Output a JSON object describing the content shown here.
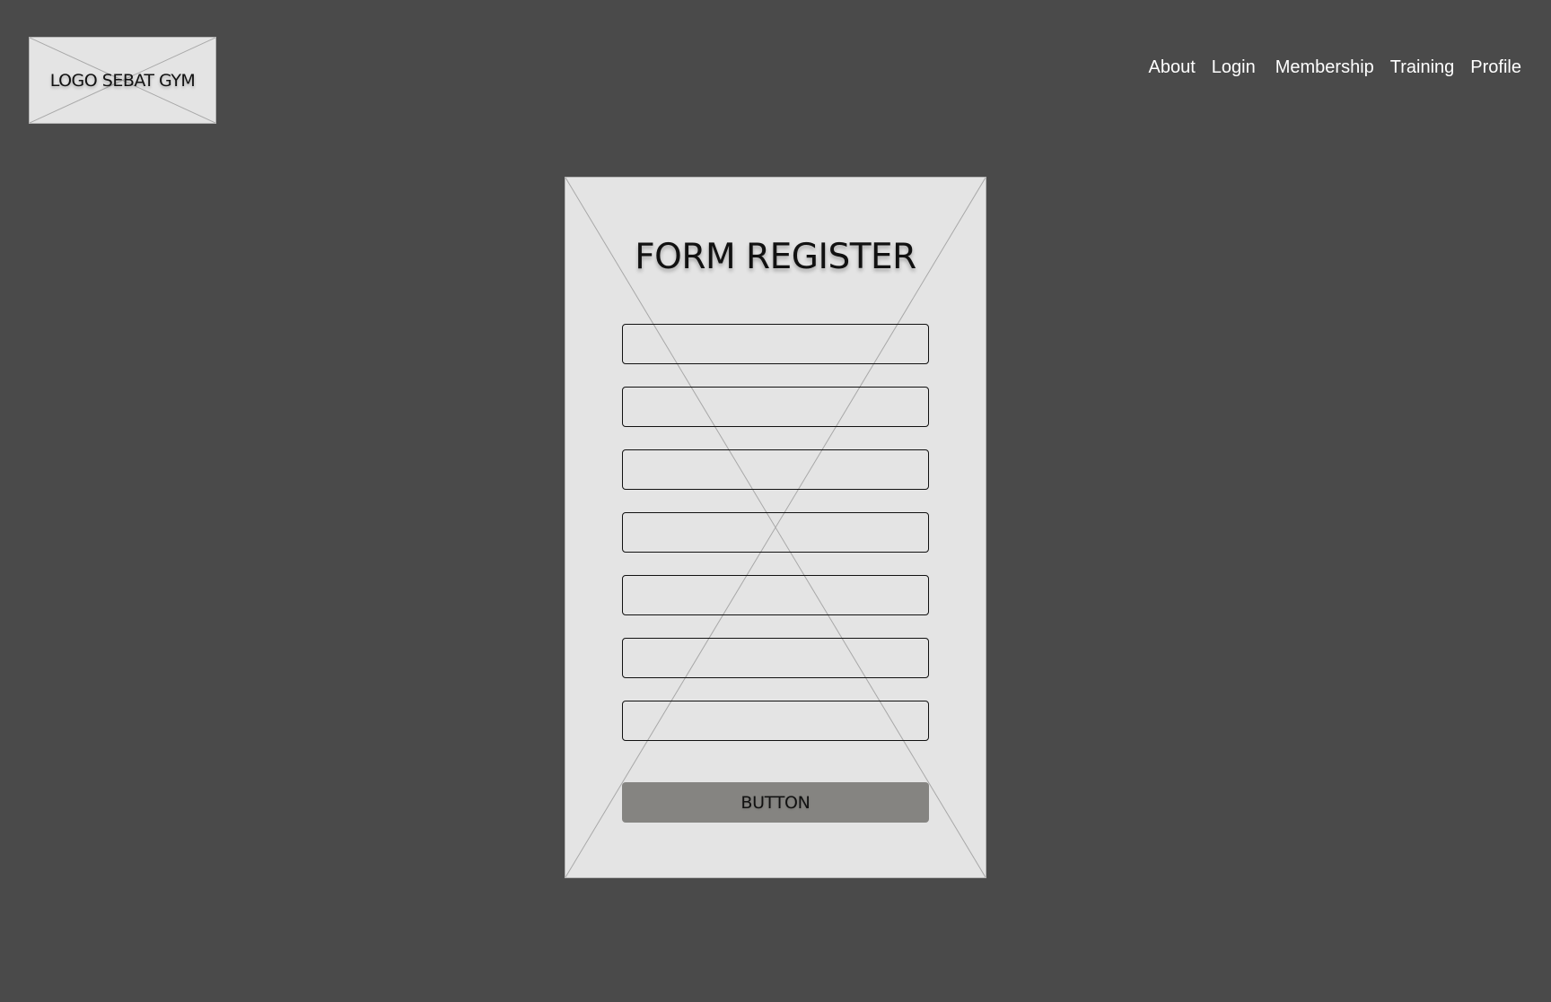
{
  "header": {
    "logo_text": "LOGO SEBAT GYM",
    "nav": [
      {
        "label": "About"
      },
      {
        "label": "Login"
      },
      {
        "label": "Membership"
      },
      {
        "label": "Training"
      },
      {
        "label": "Profile"
      }
    ]
  },
  "form": {
    "title": "FORM REGISTER",
    "fields": [
      {
        "value": ""
      },
      {
        "value": ""
      },
      {
        "value": ""
      },
      {
        "value": ""
      },
      {
        "value": ""
      },
      {
        "value": ""
      },
      {
        "value": ""
      }
    ],
    "button_label": "BUTTON"
  },
  "colors": {
    "background": "#4a4a4a",
    "placeholder_fill": "#e4e4e4",
    "placeholder_border": "#b5b5b5",
    "button_fill": "#858481",
    "nav_text": "#ffffff"
  }
}
